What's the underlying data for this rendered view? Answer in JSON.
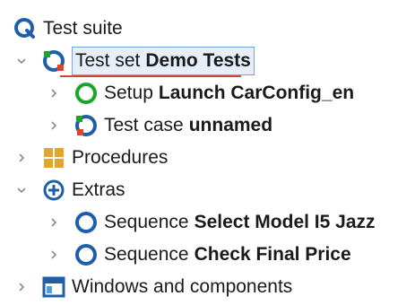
{
  "tree": {
    "root": {
      "label": "Test suite",
      "icon": "qf-test-logo-icon"
    },
    "test_set": {
      "prefix": "Test set",
      "name": "Demo Tests",
      "icon": "test-set-icon"
    },
    "setup": {
      "prefix": "Setup",
      "name": "Launch CarConfig_en",
      "icon": "setup-icon"
    },
    "test_case": {
      "prefix": "Test case",
      "name": "unnamed",
      "icon": "test-case-icon"
    },
    "procedures": {
      "label": "Procedures",
      "icon": "procedures-icon"
    },
    "extras": {
      "label": "Extras",
      "icon": "extras-icon"
    },
    "sequence1": {
      "prefix": "Sequence",
      "name": "Select Model I5 Jazz",
      "icon": "sequence-icon"
    },
    "sequence2": {
      "prefix": "Sequence",
      "name": "Check Final Price",
      "icon": "sequence-icon"
    },
    "windows": {
      "label": "Windows and components",
      "icon": "windows-components-icon"
    }
  },
  "colors": {
    "logo_blue": "#1f5fa9",
    "setup_green": "#1aa52f",
    "sequence_blue": "#1f5fa9",
    "procedures_orange": "#e3a52c",
    "selection_border": "#7aa3d6",
    "selection_bg": "#e6eef9",
    "underline_red": "#d8462c"
  }
}
